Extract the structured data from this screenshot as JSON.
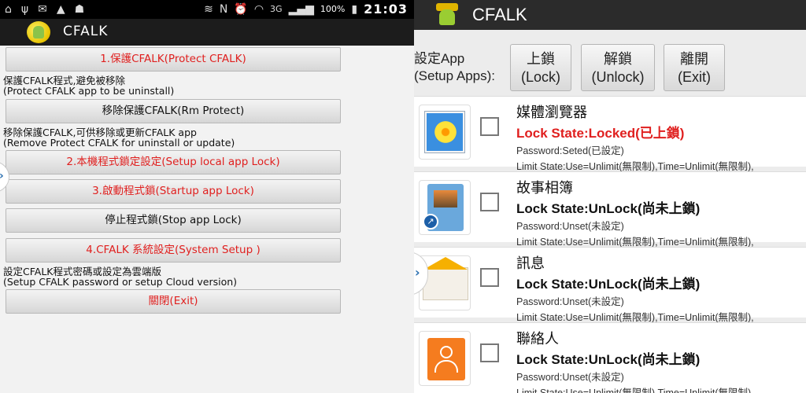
{
  "left": {
    "status_bar": {
      "icons": [
        "home-icon",
        "usb-icon",
        "mail-icon",
        "warning-icon",
        "android-icon"
      ],
      "right_icons": [
        "vibrate-icon",
        "nfc-icon",
        "alarm-icon",
        "wifi-icon",
        "3g-icon",
        "signal-icon"
      ],
      "network_label": "3G",
      "battery": "100%",
      "time": "21:03"
    },
    "app_title": "CFALK",
    "buttons": {
      "protect": "1.保護CFALK(Protect CFALK)",
      "rm_protect": "移除保護CFALK(Rm Protect)",
      "local_lock": "2.本機程式鎖定設定(Setup local app Lock)",
      "startup_lock": "3.啟動程式鎖(Startup app Lock)",
      "stop_lock": "停止程式鎖(Stop app Lock)",
      "system_setup": "4.CFALK 系統設定(System Setup )",
      "exit": "關閉(Exit)"
    },
    "texts": {
      "protect_desc_1": "保護CFALK程式,避免被移除",
      "protect_desc_2": "(Protect CFALK app to be uninstall)",
      "rm_desc_1": "移除保護CFALK,可供移除或更新CFALK app",
      "rm_desc_2": "(Remove Protect CFALK for uninstall or update)",
      "setup_desc_1": "設定CFALK程式密碼或設定為雲端版",
      "setup_desc_2": "(Setup CFALK password or setup Cloud version)"
    }
  },
  "right": {
    "app_title": "CFALK",
    "setup_label_1": "設定App",
    "setup_label_2": "(Setup Apps):",
    "buttons": [
      {
        "line1": "上鎖",
        "line2": "(Lock)"
      },
      {
        "line1": "解鎖",
        "line2": "(Unlock)"
      },
      {
        "line1": "離開",
        "line2": "(Exit)"
      }
    ],
    "apps": [
      {
        "name": "媒體瀏覽器",
        "lock_state": "Lock State:Locked(已上鎖)",
        "password": "Password:Seted(已設定)",
        "limit": "Limit State:Use=Unlimit(無限制),Time=Unlimit(無限制),"
      },
      {
        "name": "故事相簿",
        "lock_state": "Lock State:UnLock(尚未上鎖)",
        "password": "Password:Unset(未設定)",
        "limit": "Limit State:Use=Unlimit(無限制),Time=Unlimit(無限制),"
      },
      {
        "name": "訊息",
        "lock_state": "Lock State:UnLock(尚未上鎖)",
        "password": "Password:Unset(未設定)",
        "limit": "Limit State:Use=Unlimit(無限制),Time=Unlimit(無限制),"
      },
      {
        "name": "聯絡人",
        "lock_state": "Lock State:UnLock(尚未上鎖)",
        "password": "Password:Unset(未設定)",
        "limit": "Limit State:Use=Unlimit(無限制),Time=Unlimit(無限制),"
      }
    ]
  },
  "colors": {
    "accent_red": "#e0201f",
    "action_bar": "#1c1c1c"
  }
}
